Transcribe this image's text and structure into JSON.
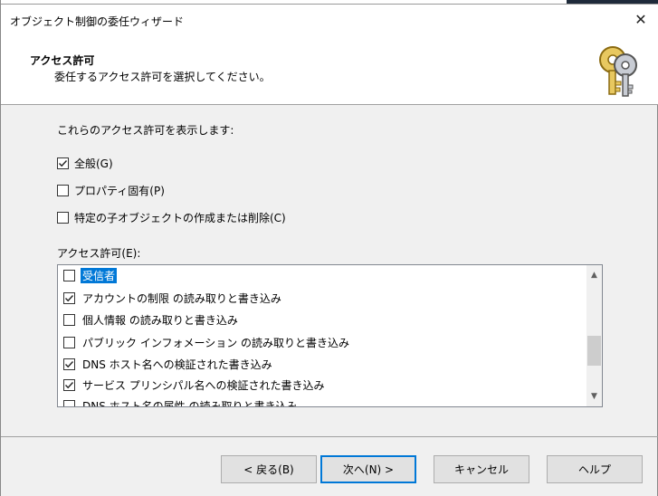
{
  "window": {
    "title": "オブジェクト制御の委任ウィザード",
    "close_glyph": "✕"
  },
  "header": {
    "title": "アクセス許可",
    "subtitle": "委任するアクセス許可を選択してください。",
    "icon": "keys-icon"
  },
  "filters": {
    "label": "これらのアクセス許可を表示します:",
    "options": [
      {
        "label": "全般(G)",
        "checked": true
      },
      {
        "label": "プロパティ固有(P)",
        "checked": false
      },
      {
        "label": "特定の子オブジェクトの作成または削除(C)",
        "checked": false
      }
    ]
  },
  "permissions": {
    "label": "アクセス許可(E):",
    "items": [
      {
        "label": "受信者",
        "checked": false,
        "selected": true
      },
      {
        "label": "アカウントの制限 の読み取りと書き込み",
        "checked": true,
        "selected": false
      },
      {
        "label": "個人情報 の読み取りと書き込み",
        "checked": false,
        "selected": false
      },
      {
        "label": "パブリック インフォメーション の読み取りと書き込み",
        "checked": false,
        "selected": false
      },
      {
        "label": "DNS ホスト名への検証された書き込み",
        "checked": true,
        "selected": false
      },
      {
        "label": "サービス プリンシパル名への検証された書き込み",
        "checked": true,
        "selected": false
      },
      {
        "label": "DNS ホスト名の属性 の読み取りと書き込み",
        "checked": false,
        "selected": false
      }
    ]
  },
  "buttons": {
    "back": "< 戻る(B)",
    "next": "次へ(N) >",
    "cancel": "キャンセル",
    "help": "ヘルプ"
  },
  "colors": {
    "accent": "#0078d7",
    "dialog_bg": "#f0f0f0"
  }
}
